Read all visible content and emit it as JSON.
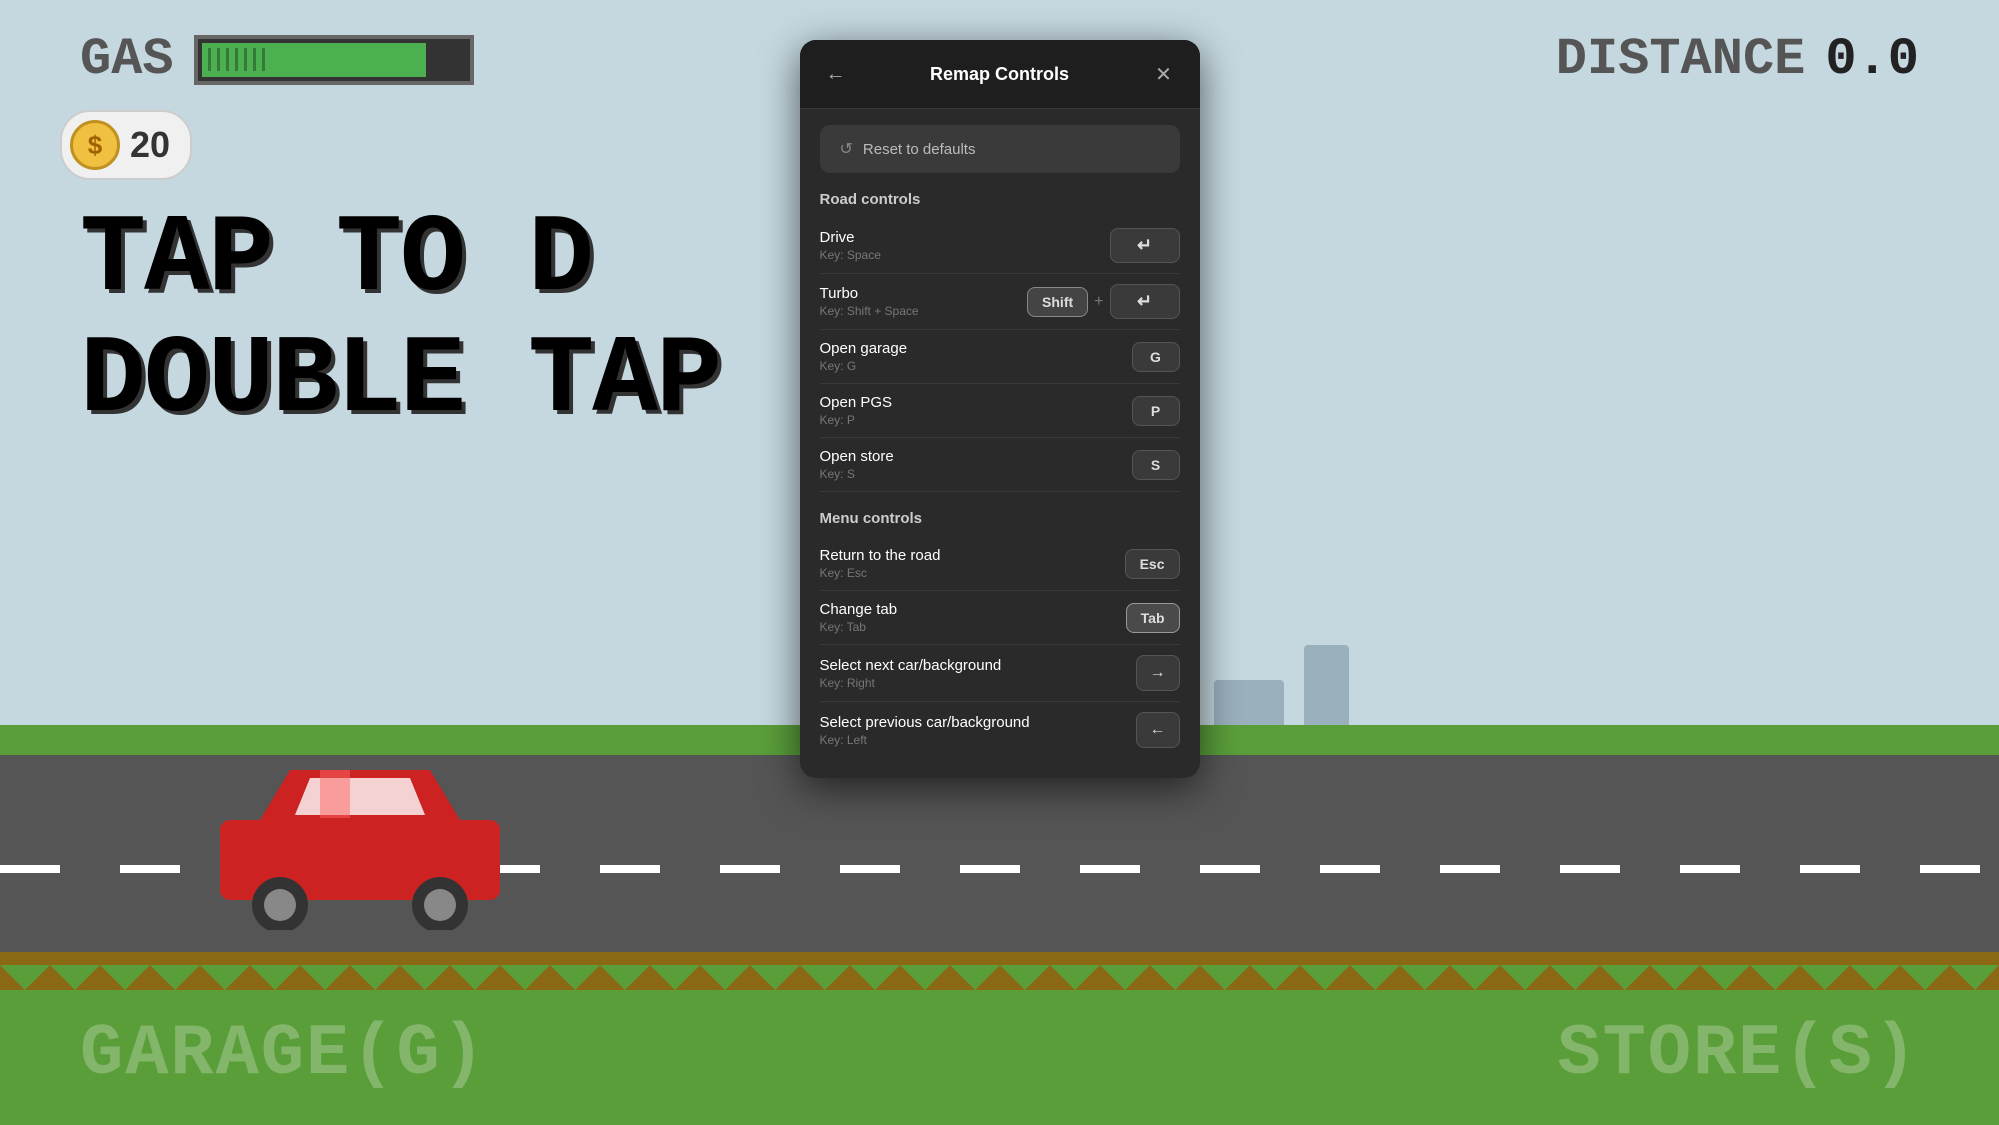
{
  "game": {
    "gas_label": "GAS",
    "distance_label": "DISTANCE",
    "distance_value": "0.0",
    "coin_count": "20",
    "tap_line1": "TAP TO D",
    "tap_line2": "DOUBLE TAP",
    "bottom_left": "GARAGE(G)",
    "bottom_right": "STORE(S)"
  },
  "modal": {
    "title": "Remap Controls",
    "back_icon": "←",
    "close_icon": "✕",
    "reset_label": "Reset to defaults",
    "reset_icon": "↺",
    "road_controls_heading": "Road controls",
    "menu_controls_heading": "Menu controls",
    "controls": [
      {
        "section": "road",
        "name": "Drive",
        "key_hint": "Key: Space",
        "binding_type": "single_space",
        "keys": [
          "↵"
        ]
      },
      {
        "section": "road",
        "name": "Turbo",
        "key_hint": "Key: Shift + Space",
        "binding_type": "combo",
        "keys": [
          "Shift",
          "↵"
        ]
      },
      {
        "section": "road",
        "name": "Open garage",
        "key_hint": "Key: G",
        "binding_type": "single",
        "keys": [
          "G"
        ]
      },
      {
        "section": "road",
        "name": "Open PGS",
        "key_hint": "Key: P",
        "binding_type": "single",
        "keys": [
          "P"
        ]
      },
      {
        "section": "road",
        "name": "Open store",
        "key_hint": "Key: S",
        "binding_type": "single",
        "keys": [
          "S"
        ]
      },
      {
        "section": "menu",
        "name": "Return to the road",
        "key_hint": "Key: Esc",
        "binding_type": "single",
        "keys": [
          "Esc"
        ]
      },
      {
        "section": "menu",
        "name": "Change tab",
        "key_hint": "Key: Tab",
        "binding_type": "single_highlight",
        "keys": [
          "Tab"
        ]
      },
      {
        "section": "menu",
        "name": "Select next car/background",
        "key_hint": "Key: Right",
        "binding_type": "arrow",
        "keys": [
          "→"
        ]
      },
      {
        "section": "menu",
        "name": "Select previous car/background",
        "key_hint": "Key: Left",
        "binding_type": "arrow",
        "keys": [
          "←"
        ]
      }
    ]
  }
}
